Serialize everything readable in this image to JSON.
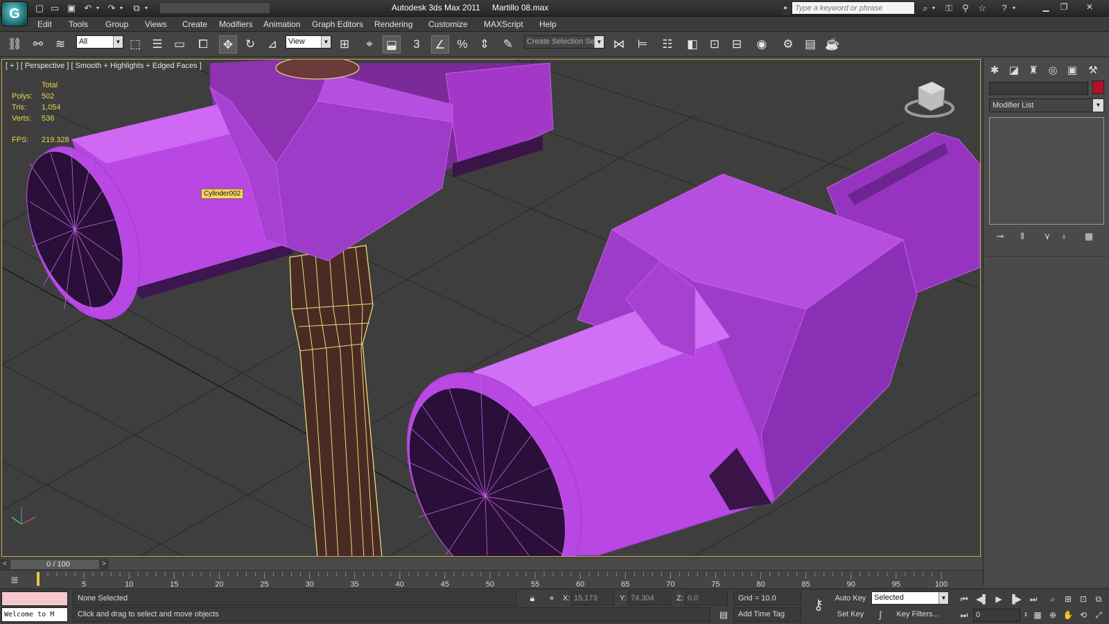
{
  "titlebar": {
    "app_title": "Autodesk 3ds Max  2011",
    "file_title": "Martillo 08.max",
    "search_placeholder": "Type a keyword or phrase"
  },
  "menu": [
    "Edit",
    "Tools",
    "Group",
    "Views",
    "Create",
    "Modifiers",
    "Animation",
    "Graph Editors",
    "Rendering",
    "Customize",
    "MAXScript",
    "Help"
  ],
  "toolbar": {
    "selection_filter": "All",
    "reference_coord": "View",
    "named_selection_placeholder": "Create Selection Se",
    "snap_label": "3",
    "angle_snap_label": "",
    "percent_snap_label": "%"
  },
  "viewport": {
    "label": "[ + ] [ Perspective ] [ Smooth + Highlights + Edged Faces ]",
    "stats": {
      "total_label": "Total",
      "polys_label": "Polys:",
      "polys": "502",
      "tris_label": "Tris:",
      "tris": "1,054",
      "verts_label": "Verts:",
      "verts": "536",
      "fps_label": "FPS:",
      "fps": "219.328"
    },
    "object_tooltip": "Cylinder002",
    "colors": {
      "object": "#b43fe0",
      "handle": "#4a2b24",
      "handle_wire": "#e8e07a",
      "grid": "#2a2a2a",
      "background": "#3e3e3e"
    }
  },
  "command_panel": {
    "modifier_list": "Modifier List",
    "object_color": "#b0122d"
  },
  "timeline": {
    "frame_display": "0 / 100",
    "prev_label": "<",
    "next_label": ">",
    "ticks": [
      "5",
      "10",
      "15",
      "20",
      "25",
      "30",
      "35",
      "40",
      "45",
      "50",
      "55",
      "60",
      "65",
      "70",
      "75",
      "80",
      "85",
      "90",
      "95",
      "100"
    ]
  },
  "status": {
    "listener_text": "Welcome to M",
    "selection": "None Selected",
    "prompt": "Click and drag to select and move objects",
    "x_label": "X:",
    "x_value": "15.173",
    "y_label": "Y:",
    "y_value": "74.304",
    "z_label": "Z:",
    "z_value": "0.0",
    "grid": "Grid = 10.0",
    "add_time_tag": "Add Time Tag",
    "auto_key": "Auto Key",
    "set_key": "Set Key",
    "key_mode": "Selected",
    "key_filters": "Key Filters...",
    "current_frame": "0"
  }
}
